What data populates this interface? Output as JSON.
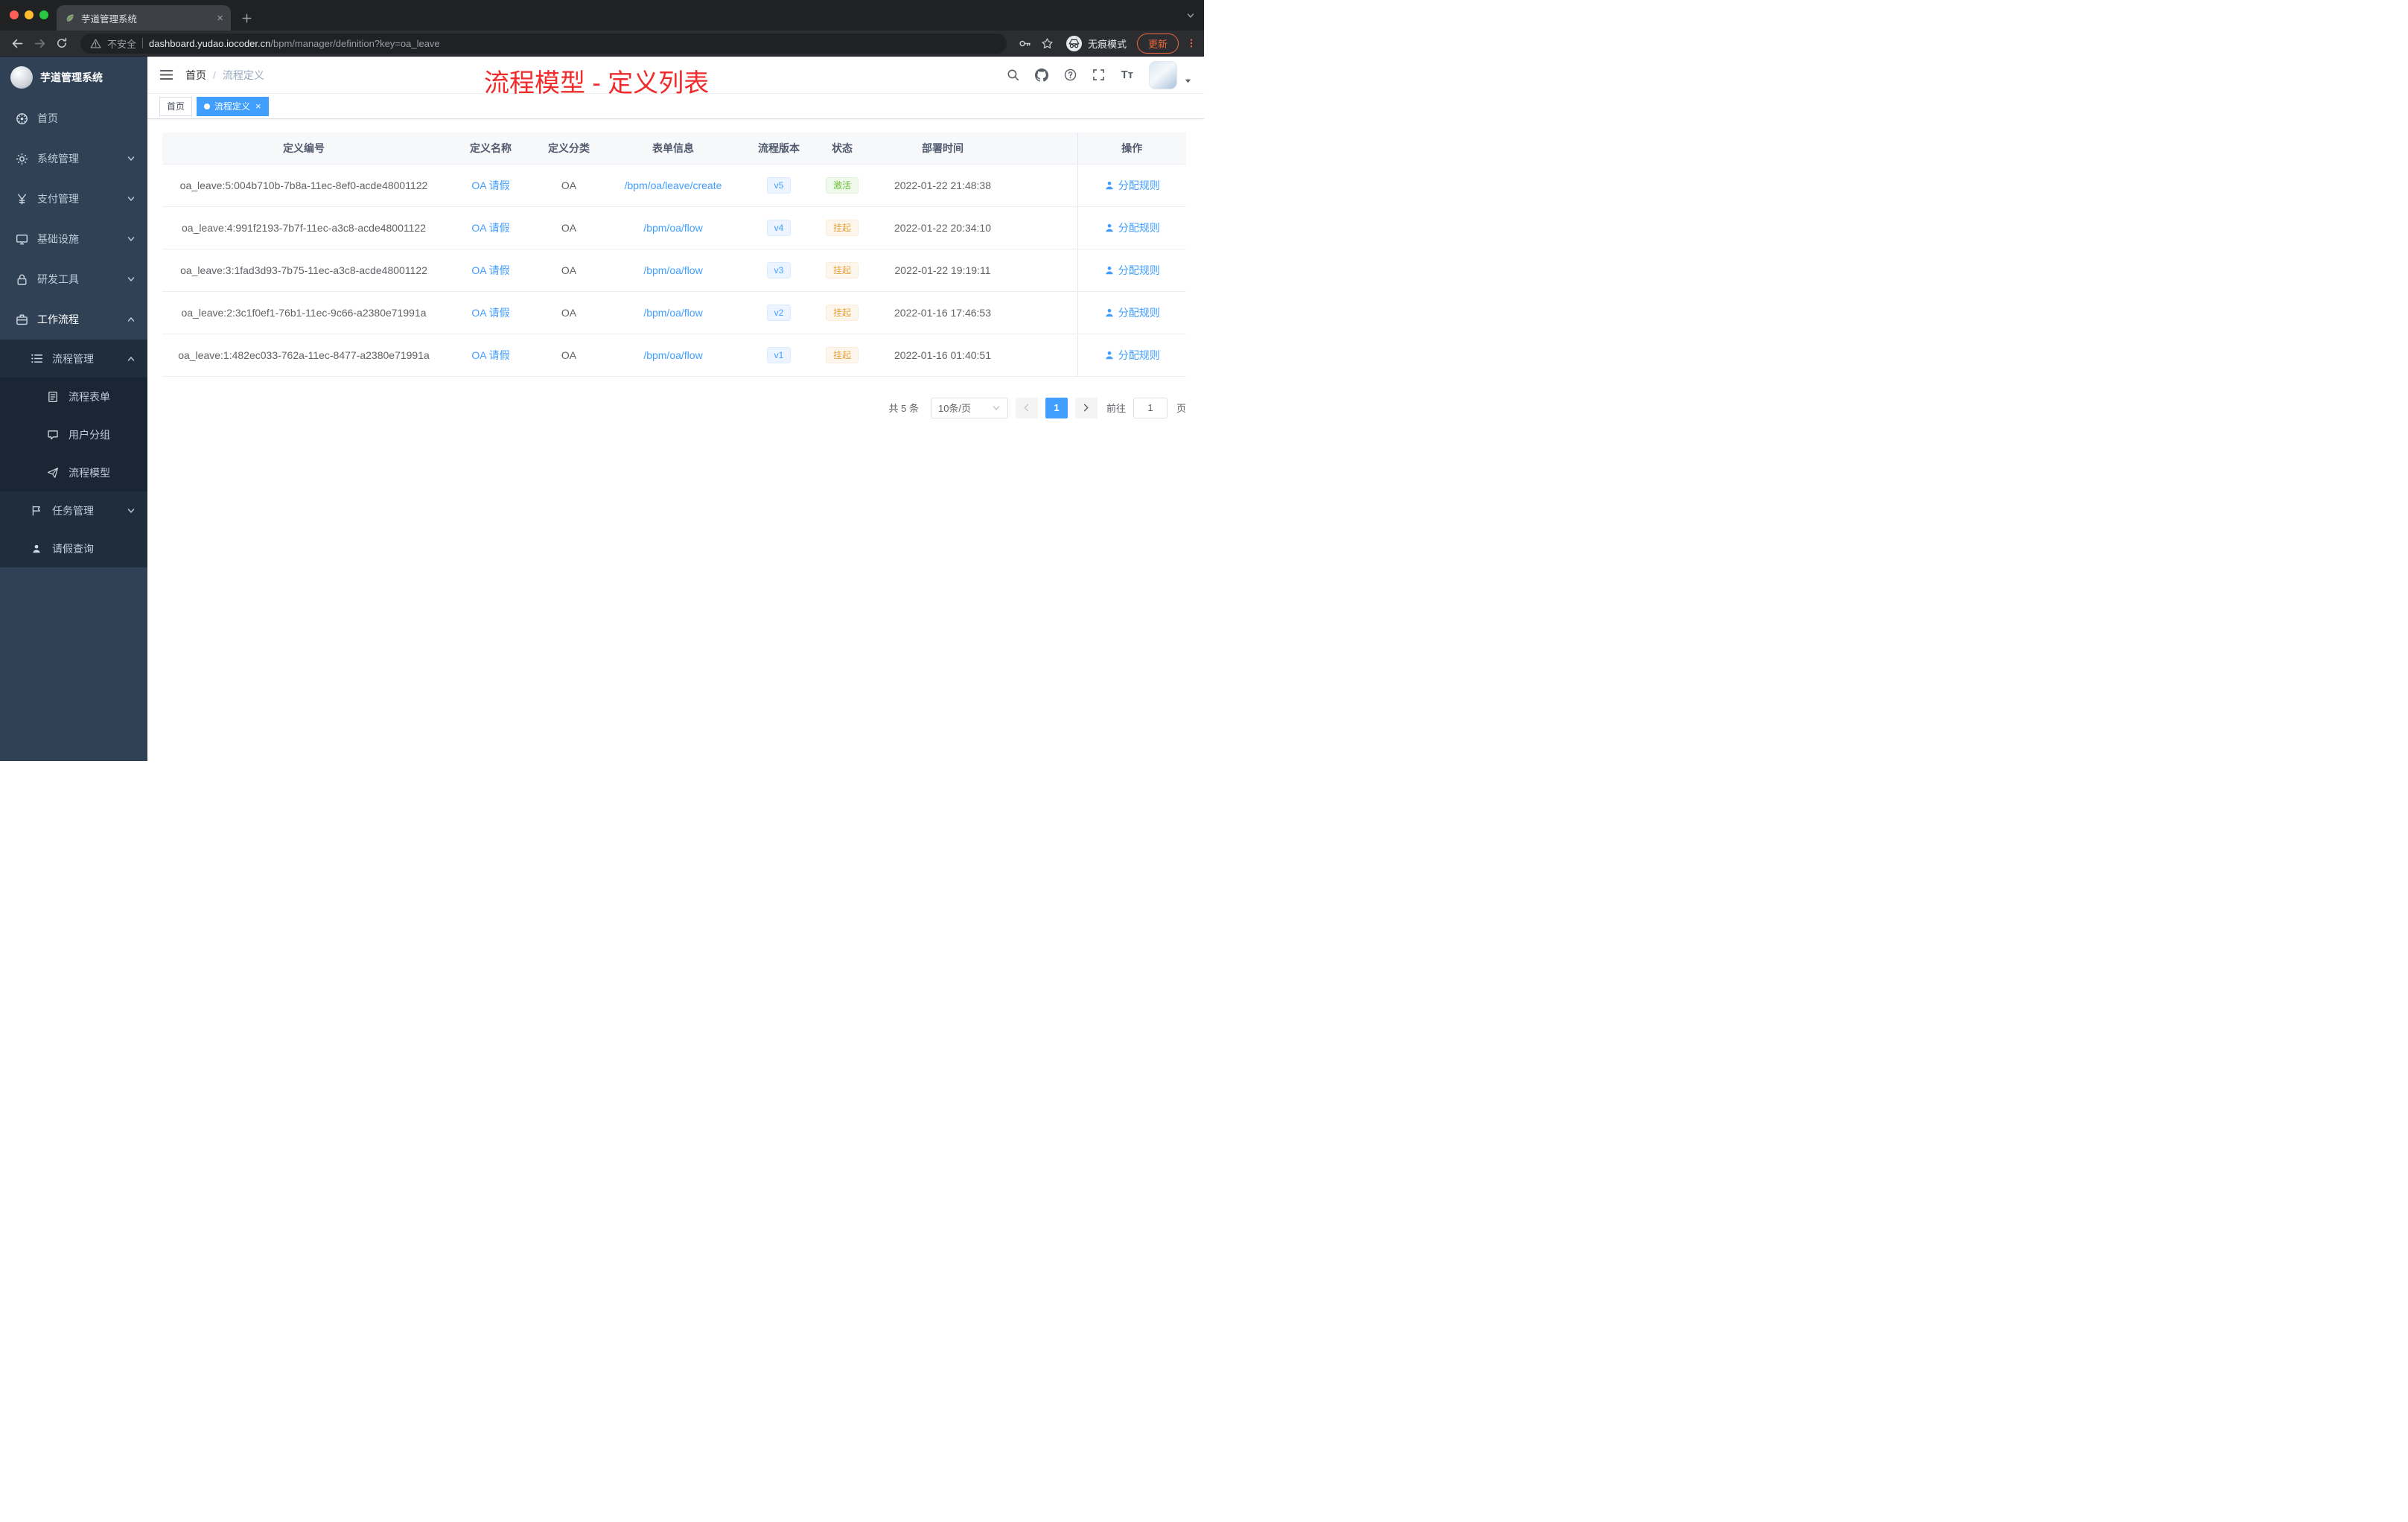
{
  "browser": {
    "tab": {
      "title": "芋道管理系统"
    },
    "toolbar": {
      "security_label": "不安全",
      "url_host": "dashboard.yudao.iocoder.cn",
      "url_path": "/bpm/manager/definition?key=oa_leave",
      "incognito_label": "无痕模式",
      "update_label": "更新"
    }
  },
  "sidebar": {
    "logo_title": "芋道管理系统",
    "menu": [
      {
        "id": "home",
        "label": "首页",
        "icon": "dashboard-icon",
        "level": 0
      },
      {
        "id": "system",
        "label": "系统管理",
        "icon": "gear-icon",
        "level": 0,
        "chevron": "down"
      },
      {
        "id": "payment",
        "label": "支付管理",
        "icon": "yen-icon",
        "level": 0,
        "chevron": "down"
      },
      {
        "id": "infrastructure",
        "label": "基础设施",
        "icon": "monitor-icon",
        "level": 0,
        "chevron": "down"
      },
      {
        "id": "devtools",
        "label": "研发工具",
        "icon": "lock-icon",
        "level": 0,
        "chevron": "down"
      },
      {
        "id": "workflow",
        "label": "工作流程",
        "icon": "briefcase-icon",
        "level": 0,
        "chevron": "up",
        "active": true
      },
      {
        "id": "process-management",
        "label": "流程管理",
        "icon": "list-icon",
        "level": 1,
        "chevron": "up"
      },
      {
        "id": "process-form",
        "label": "流程表单",
        "icon": "document-icon",
        "level": 2
      },
      {
        "id": "user-group",
        "label": "用户分组",
        "icon": "chat-icon",
        "level": 2
      },
      {
        "id": "process-model",
        "label": "流程模型",
        "icon": "send-icon",
        "level": 2
      },
      {
        "id": "task-management",
        "label": "任务管理",
        "icon": "flag-icon",
        "level": 1,
        "chevron": "down"
      },
      {
        "id": "leave-query",
        "label": "请假查询",
        "icon": "person-icon",
        "level": 1
      }
    ]
  },
  "header": {
    "breadcrumb": {
      "root": "首页",
      "separator": "/",
      "current": "流程定义"
    },
    "annotation": "流程模型 - 定义列表"
  },
  "tags": [
    {
      "label": "首页",
      "active": false,
      "closable": false
    },
    {
      "label": "流程定义",
      "active": true,
      "closable": true
    }
  ],
  "table": {
    "columns": [
      "定义编号",
      "定义名称",
      "定义分类",
      "表单信息",
      "流程版本",
      "状态",
      "部署时间",
      "操作"
    ],
    "rows": [
      {
        "id": "oa_leave:5:004b710b-7b8a-11ec-8ef0-acde48001122",
        "name": "OA 请假",
        "category": "OA",
        "form": "/bpm/oa/leave/create",
        "version": "v5",
        "status": "激活",
        "status_type": "success",
        "deploy_time": "2022-01-22 21:48:38",
        "action": "分配规则"
      },
      {
        "id": "oa_leave:4:991f2193-7b7f-11ec-a3c8-acde48001122",
        "name": "OA 请假",
        "category": "OA",
        "form": "/bpm/oa/flow",
        "version": "v4",
        "status": "挂起",
        "status_type": "warning",
        "deploy_time": "2022-01-22 20:34:10",
        "action": "分配规则"
      },
      {
        "id": "oa_leave:3:1fad3d93-7b75-11ec-a3c8-acde48001122",
        "name": "OA 请假",
        "category": "OA",
        "form": "/bpm/oa/flow",
        "version": "v3",
        "status": "挂起",
        "status_type": "warning",
        "deploy_time": "2022-01-22 19:19:11",
        "action": "分配规则"
      },
      {
        "id": "oa_leave:2:3c1f0ef1-76b1-11ec-9c66-a2380e71991a",
        "name": "OA 请假",
        "category": "OA",
        "form": "/bpm/oa/flow",
        "version": "v2",
        "status": "挂起",
        "status_type": "warning",
        "deploy_time": "2022-01-16 17:46:53",
        "action": "分配规则"
      },
      {
        "id": "oa_leave:1:482ec033-762a-11ec-8477-a2380e71991a",
        "name": "OA 请假",
        "category": "OA",
        "form": "/bpm/oa/flow",
        "version": "v1",
        "status": "挂起",
        "status_type": "warning",
        "deploy_time": "2022-01-16 01:40:51",
        "action": "分配规则"
      }
    ]
  },
  "pagination": {
    "total": "共 5 条",
    "page_size": "10条/页",
    "current": "1",
    "goto_prefix": "前往",
    "goto_value": "1",
    "goto_suffix": "页"
  }
}
